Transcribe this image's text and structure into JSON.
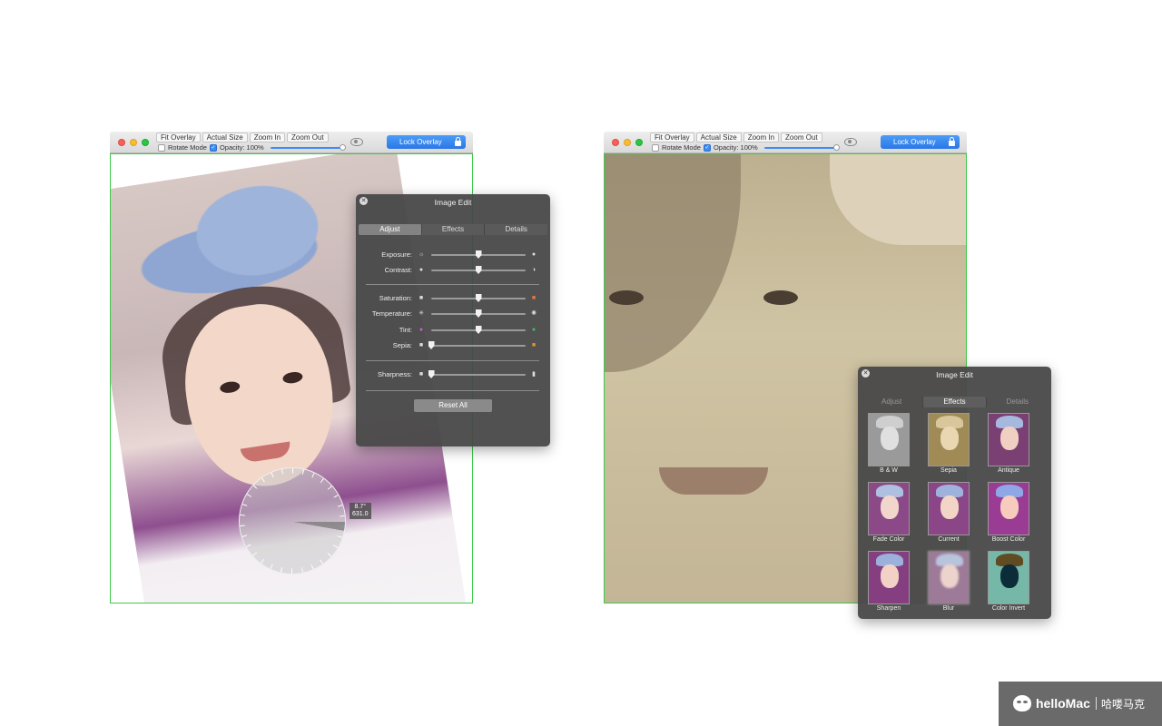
{
  "overlay_windows": [
    {
      "toolbar": {
        "fit_overlay": "Fit Overlay",
        "actual_size": "Actual Size",
        "zoom_in": "Zoom In",
        "zoom_out": "Zoom Out",
        "rotate_mode": "Rotate Mode",
        "rotate_mode_checked": false,
        "opacity_label": "Opacity: 100%",
        "opacity_checked": true,
        "opacity_value": 100,
        "lock_overlay": "Lock Overlay"
      },
      "rotation_readout": {
        "angle": "8.7°",
        "value": "631.0"
      }
    },
    {
      "toolbar": {
        "fit_overlay": "Fit Overlay",
        "actual_size": "Actual Size",
        "zoom_in": "Zoom In",
        "zoom_out": "Zoom Out",
        "rotate_mode": "Rotate Mode",
        "rotate_mode_checked": false,
        "opacity_label": "Opacity: 100%",
        "opacity_checked": true,
        "opacity_value": 100,
        "lock_overlay": "Lock Overlay"
      }
    }
  ],
  "image_edit_adjust": {
    "title": "Image Edit",
    "tabs": [
      "Adjust",
      "Effects",
      "Details"
    ],
    "active_tab": "Adjust",
    "sliders": [
      {
        "label": "Exposure:",
        "min_icon": "small-sun-icon",
        "max_icon": "large-sun-icon",
        "value": 0.5
      },
      {
        "label": "Contrast:",
        "min_icon": "circle-filled-icon",
        "max_icon": "half-circle-icon",
        "value": 0.5
      },
      {
        "label": "Saturation:",
        "min_icon": "gray-square-icon",
        "max_icon": "color-square-icon",
        "value": 0.5
      },
      {
        "label": "Temperature:",
        "min_icon": "snowflake-icon",
        "max_icon": "sun-rays-icon",
        "value": 0.5
      },
      {
        "label": "Tint:",
        "min_icon": "magenta-dot-icon",
        "max_icon": "green-dot-icon",
        "value": 0.5
      },
      {
        "label": "Sepia:",
        "min_icon": "white-square-icon",
        "max_icon": "orange-square-icon",
        "value": 0.0
      },
      {
        "label": "Sharpness:",
        "min_icon": "blur-square-icon",
        "max_icon": "sharp-square-icon",
        "value": 0.0
      }
    ],
    "reset_all": "Reset All"
  },
  "image_edit_effects": {
    "title": "Image Edit",
    "tabs": [
      "Adjust",
      "Effects",
      "Details"
    ],
    "active_tab": "Effects",
    "effects": [
      {
        "label": "B & W",
        "bg": "#9a9a9a",
        "face": "#e0e0e0",
        "towel": "#cfcfcf"
      },
      {
        "label": "Sepia",
        "bg": "#a08a56",
        "face": "#e8d7b0",
        "towel": "#d8c79c"
      },
      {
        "label": "Antique",
        "bg": "#7a3f73",
        "face": "#f0d0c3",
        "towel": "#a7b8df"
      },
      {
        "label": "Fade Color",
        "bg": "#8b4a87",
        "face": "#f2d6cc",
        "towel": "#aebfe0"
      },
      {
        "label": "Current",
        "bg": "#8a4686",
        "face": "#f3d5c8",
        "towel": "#9fb2dc"
      },
      {
        "label": "Boost Color",
        "bg": "#9a3c93",
        "face": "#f7cbbd",
        "towel": "#8fa7e6"
      },
      {
        "label": "Sharpen",
        "bg": "#853f81",
        "face": "#f2d2c6",
        "towel": "#9cb0dc"
      },
      {
        "label": "Blur",
        "bg": "#9d7a98",
        "face": "#ecd3cb",
        "towel": "#b8c3dc"
      },
      {
        "label": "Color Invert",
        "bg": "#76b8a7",
        "face": "#0d2c3a",
        "towel": "#614b22"
      }
    ]
  },
  "watermark": {
    "brand": "helloMac",
    "cn": "哈喽马克"
  },
  "colors": {
    "accent": "#3b8cf5",
    "overlay_border": "#3dc94a",
    "panel_bg": "#484848"
  }
}
